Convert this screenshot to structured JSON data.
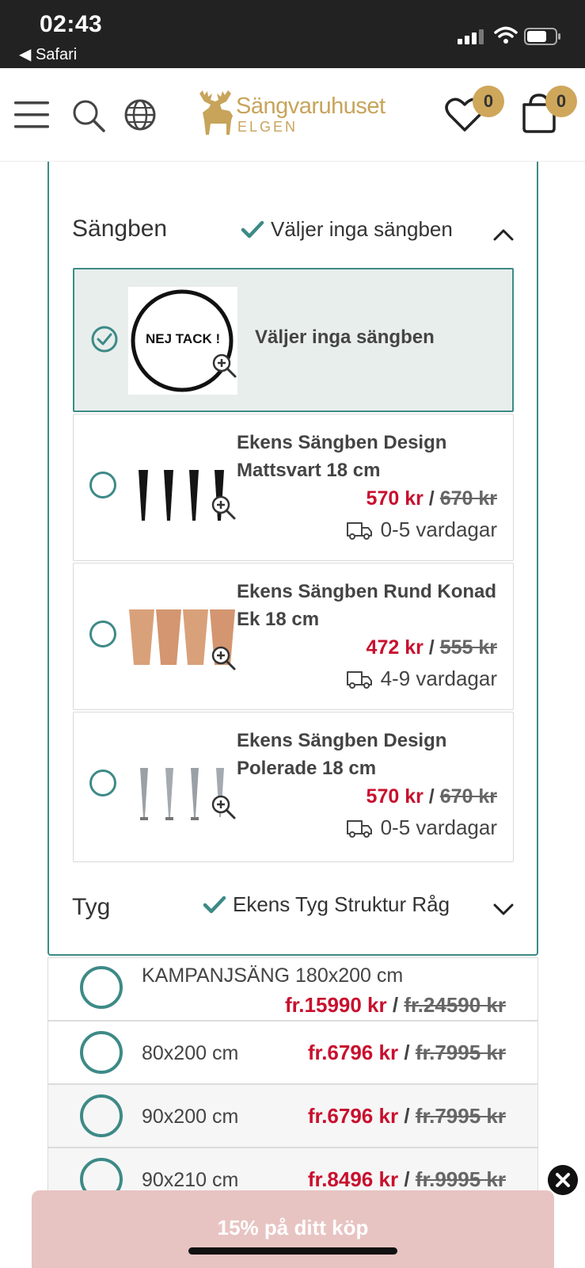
{
  "status_bar": {
    "time": "02:43",
    "back_app": "◀ Safari"
  },
  "header": {
    "logo_brand": "Sängvaruhuset",
    "logo_sub": "ELGEN",
    "wishlist_count": "0",
    "cart_count": "0",
    "brand_color": "#cfa75b"
  },
  "sections": {
    "legs": {
      "title": "Sängben",
      "selected": "Väljer inga sängben"
    },
    "fabric": {
      "title": "Tyg",
      "selected": "Ekens Tyg Struktur Råg"
    }
  },
  "leg_options": [
    {
      "thumb_text": "NEJ TACK !",
      "name": "Väljer inga sängben",
      "selected": true
    },
    {
      "name": "Ekens Sängben Design Mattsvart 18 cm",
      "price_now": "570 kr",
      "price_old": "670 kr",
      "delivery": "0-5 vardagar",
      "selected": false
    },
    {
      "name": "Ekens Sängben Rund Konad Ek 18 cm",
      "price_now": "472 kr",
      "price_old": "555 kr",
      "delivery": "4-9 vardagar",
      "selected": false
    },
    {
      "name": "Ekens Sängben Design Polerade 18 cm",
      "price_now": "570 kr",
      "price_old": "670 kr",
      "delivery": "0-5 vardagar",
      "selected": false
    }
  ],
  "price_separator": "/",
  "sizes": [
    {
      "label": "KAMPANJSÄNG 180x200 cm",
      "price_now": "fr.15990 kr",
      "price_old": "fr.24590 kr"
    },
    {
      "label": "80x200 cm",
      "price_now": "fr.6796 kr",
      "price_old": "fr.7995 kr"
    },
    {
      "label": "90x200 cm",
      "price_now": "fr.6796 kr",
      "price_old": "fr.7995 kr"
    },
    {
      "label": "90x210 cm",
      "price_now": "fr.8496 kr",
      "price_old": "fr.9995 kr"
    }
  ],
  "promo": {
    "label": "15% på ditt köp",
    "color": "#e7c4c2"
  },
  "colors": {
    "accent": "#3d8a87",
    "sale": "#c8102e"
  }
}
